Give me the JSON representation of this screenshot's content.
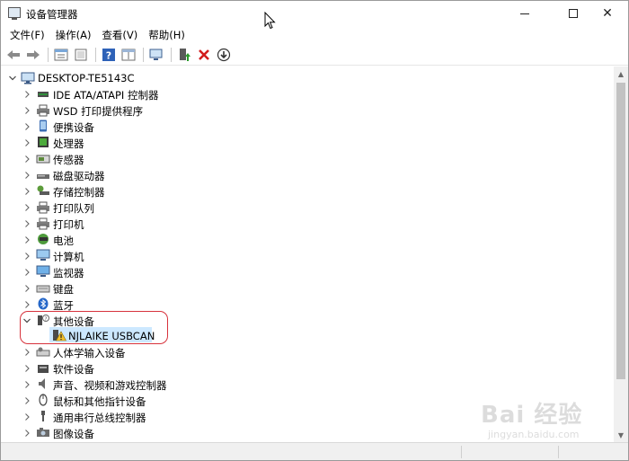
{
  "window": {
    "title": "设备管理器"
  },
  "menu": [
    "文件(F)",
    "操作(A)",
    "查看(V)",
    "帮助(H)"
  ],
  "toolbar": {
    "icons": [
      "back-arrow-icon",
      "forward-arrow-icon",
      "properties-icon",
      "list-view-icon",
      "help-icon",
      "details-view-icon",
      "scan-hardware-icon",
      "update-driver-icon",
      "uninstall-icon",
      "disable-device-icon"
    ]
  },
  "tree": {
    "root": "DESKTOP-TE5143C",
    "categories": [
      {
        "label": "IDE ATA/ATAPI 控制器",
        "icon": "ide-controller-icon",
        "expanded": false
      },
      {
        "label": "WSD 打印提供程序",
        "icon": "wsd-printer-icon",
        "expanded": false
      },
      {
        "label": "便携设备",
        "icon": "portable-device-icon",
        "expanded": false
      },
      {
        "label": "处理器",
        "icon": "processor-icon",
        "expanded": false
      },
      {
        "label": "传感器",
        "icon": "sensor-icon",
        "expanded": false
      },
      {
        "label": "磁盘驱动器",
        "icon": "disk-drive-icon",
        "expanded": false
      },
      {
        "label": "存储控制器",
        "icon": "storage-controller-icon",
        "expanded": false
      },
      {
        "label": "打印队列",
        "icon": "print-queue-icon",
        "expanded": false
      },
      {
        "label": "打印机",
        "icon": "printer-icon",
        "expanded": false
      },
      {
        "label": "电池",
        "icon": "battery-icon",
        "expanded": false
      },
      {
        "label": "计算机",
        "icon": "computer-icon",
        "expanded": false
      },
      {
        "label": "监视器",
        "icon": "monitor-icon",
        "expanded": false
      },
      {
        "label": "键盘",
        "icon": "keyboard-icon",
        "expanded": false
      },
      {
        "label": "蓝牙",
        "icon": "bluetooth-icon",
        "expanded": false
      },
      {
        "label": "其他设备",
        "icon": "other-devices-icon",
        "expanded": true,
        "children": [
          {
            "label": "NJLAIKE USBCAN",
            "icon": "unknown-device-warning-icon",
            "selected": true
          }
        ]
      },
      {
        "label": "人体学输入设备",
        "icon": "hid-icon",
        "expanded": false
      },
      {
        "label": "软件设备",
        "icon": "software-device-icon",
        "expanded": false
      },
      {
        "label": "声音、视频和游戏控制器",
        "icon": "sound-icon",
        "expanded": false
      },
      {
        "label": "鼠标和其他指针设备",
        "icon": "mouse-icon",
        "expanded": false
      },
      {
        "label": "通用串行总线控制器",
        "icon": "usb-icon",
        "expanded": false
      },
      {
        "label": "图像设备",
        "icon": "imaging-device-icon",
        "expanded": false
      }
    ]
  },
  "watermark": {
    "brand": "Bai 经验",
    "url": "jingyan.baidu.com"
  },
  "colors": {
    "selection": "#cce8ff",
    "highlight_border": "#d7323c"
  }
}
